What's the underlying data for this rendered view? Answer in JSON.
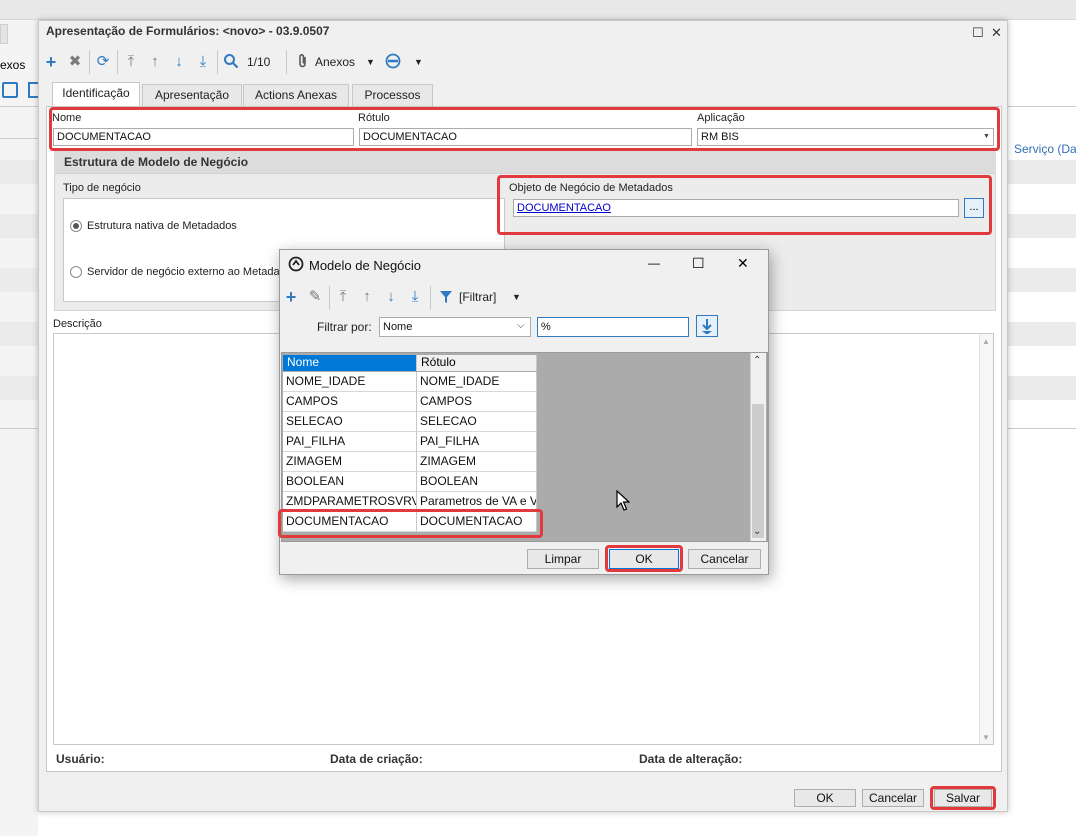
{
  "background_app": {
    "left_tab_text": "exos",
    "right_link": "Serviço (Data"
  },
  "window": {
    "title": "Apresentação de Formulários: <novo> - 03.9.0507",
    "maximize_glyph": "☐",
    "close_glyph": "✕"
  },
  "toolbar": {
    "record_counter": "1/10",
    "attachments_label": "Anexos"
  },
  "tabs": [
    {
      "label": "Identificação"
    },
    {
      "label": "Apresentação"
    },
    {
      "label": "Actions Anexas"
    },
    {
      "label": "Processos"
    }
  ],
  "identification": {
    "name_label": "Nome",
    "name_value": "DOCUMENTACAO",
    "caption_label": "Rótulo",
    "caption_value": "DOCUMENTACAO",
    "application_label": "Aplicação",
    "application_value": "RM BIS"
  },
  "business_structure": {
    "section_title": "Estrutura de Modelo de Negócio",
    "type_label": "Tipo de negócio",
    "option_native": "Estrutura nativa de Metadados",
    "option_external": "Servidor de negócio externo ao Metadados",
    "selected_option": "native",
    "metadata_object_label": "Objeto de Negócio de Metadados",
    "metadata_object_value": "DOCUMENTACAO",
    "browse_button": "..."
  },
  "description": {
    "label": "Descrição"
  },
  "footer": {
    "user_label": "Usuário:",
    "created_label": "Data de criação:",
    "modified_label": "Data de alteração:",
    "ok_button": "OK",
    "cancel_button": "Cancelar",
    "save_button": "Salvar"
  },
  "modal": {
    "title": "Modelo de Negócio",
    "minimize_glyph": "—",
    "maximize_glyph": "☐",
    "close_glyph": "✕",
    "filter_dropdown_label": "[Filtrar]",
    "filter_by_label": "Filtrar por:",
    "filter_field_value": "Nome",
    "filter_text_value": "%",
    "columns": [
      "Nome",
      "Rótulo"
    ],
    "rows": [
      {
        "name": "NOME_IDADE",
        "caption": "NOME_IDADE"
      },
      {
        "name": "CAMPOS",
        "caption": "CAMPOS"
      },
      {
        "name": "SELECAO",
        "caption": "SELECAO"
      },
      {
        "name": "PAI_FILHA",
        "caption": "PAI_FILHA"
      },
      {
        "name": "ZIMAGEM",
        "caption": "ZIMAGEM"
      },
      {
        "name": "BOOLEAN",
        "caption": "BOOLEAN"
      },
      {
        "name": "ZMDPARAMETROSVRVA",
        "caption": "Parametros de VA e VR"
      },
      {
        "name": "DOCUMENTACAO",
        "caption": "DOCUMENTACAO"
      }
    ],
    "selected_row": "DOCUMENTACAO",
    "clear_button": "Limpar",
    "ok_button": "OK",
    "cancel_button": "Cancelar"
  },
  "colors": {
    "highlight": "#e03a3e",
    "accent": "#2f7ac1",
    "selection": "#0078d7",
    "link": "#0000cc"
  }
}
